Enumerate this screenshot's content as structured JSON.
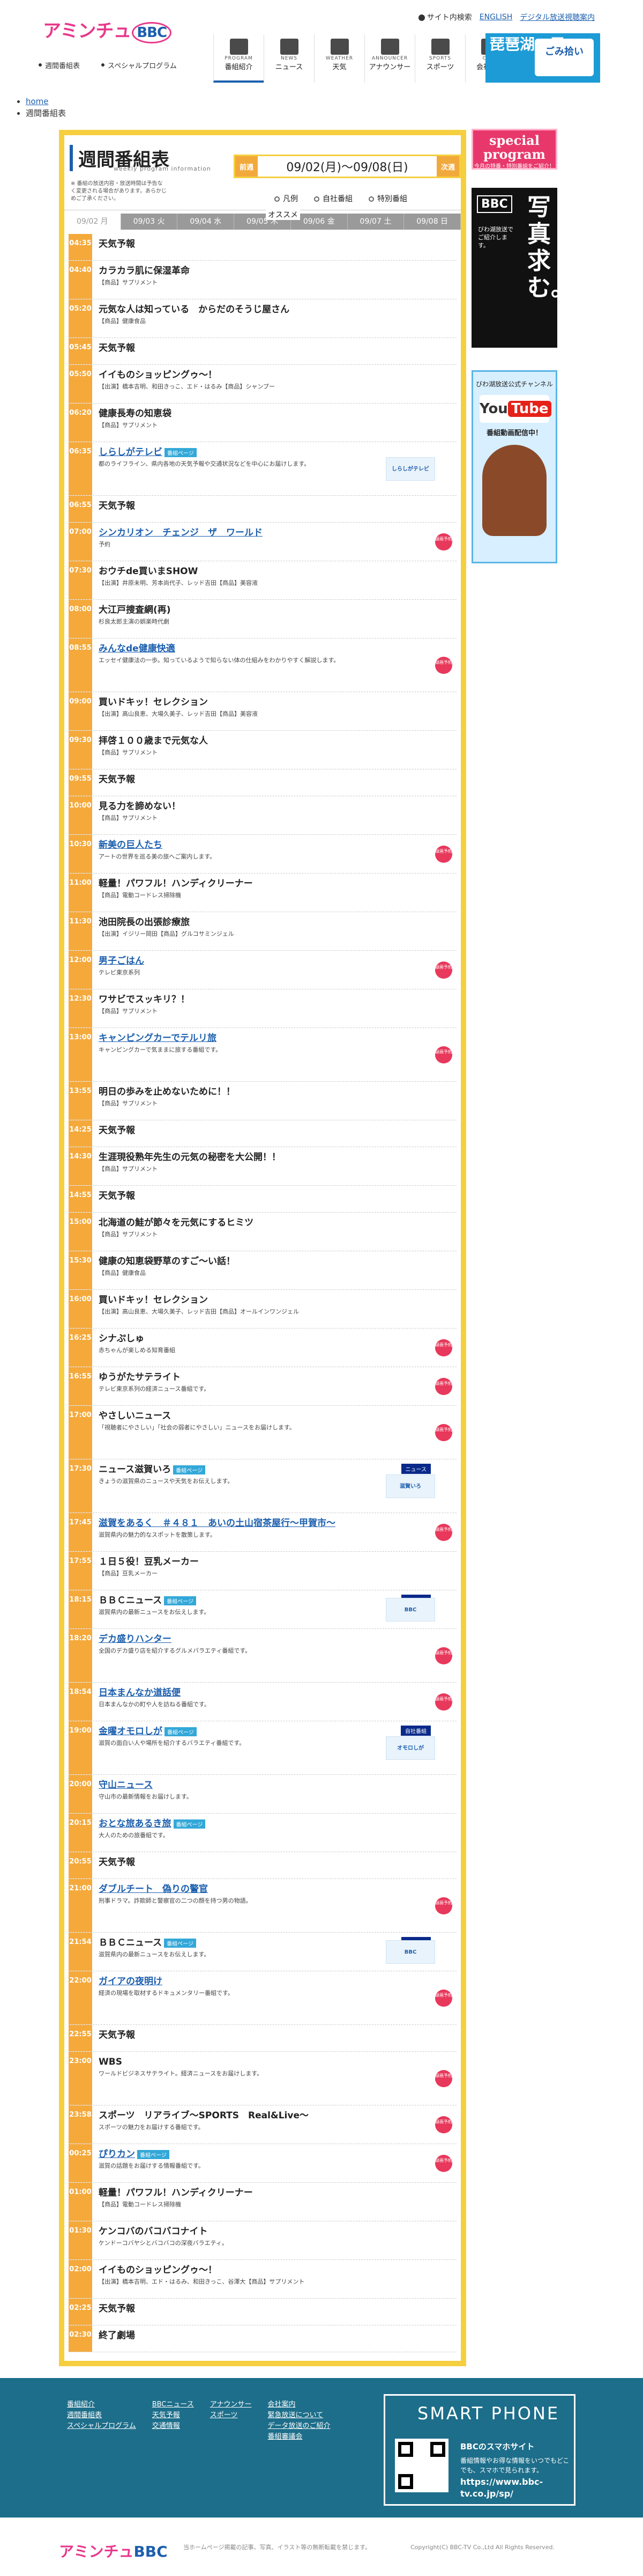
{
  "header": {
    "logo_text": "アミンチュ",
    "logo_bbc": "BBC",
    "sitemap": "サイト内検索",
    "english": "ENGLISH",
    "digital": "デジタル放送視聴案内",
    "nav": [
      {
        "en": "PROGRAM",
        "jp": "番組紹介",
        "icon": "tv-icon"
      },
      {
        "en": "NEWS",
        "jp": "ニュース",
        "icon": "news-icon"
      },
      {
        "en": "WEATHER",
        "jp": "天気",
        "icon": "weather-icon"
      },
      {
        "en": "ANNOUNCER",
        "jp": "アナウンサー",
        "icon": "microphone-icon"
      },
      {
        "en": "SPORTS",
        "jp": "スポーツ",
        "icon": "sports-icon"
      },
      {
        "en": "CORP",
        "jp": "会社案内",
        "icon": "building-icon"
      }
    ],
    "subnav": [
      "週間番組表",
      "スペシャルプログラム"
    ],
    "banner_title": "琵琶湖一周",
    "banner_sub": "ごみ拾い"
  },
  "breadcrumb": [
    "home",
    "週間番組表"
  ],
  "page": {
    "title": "週間番組表",
    "subtitle": "weekly program information",
    "note": "※ 番組の放送内容・放送時間は予告なく変更される場合があります。あらかじめご了承ください。",
    "prev": "前週",
    "next": "次週",
    "range": "09/02(月)〜09/08(日)",
    "legend": [
      "凡例",
      "自社番組",
      "特別番組"
    ],
    "osusume": "オススメ",
    "days": [
      "09/02 月",
      "09/03 火",
      "09/04 水",
      "09/05 木",
      "09/06 金",
      "09/07 土",
      "09/08 日"
    ]
  },
  "schedule": [
    {
      "time": "04:35",
      "title": "天気予報",
      "desc": ""
    },
    {
      "time": "04:40",
      "title": "カラカラ肌に保湿革命",
      "desc": "【商品】サプリメント"
    },
    {
      "time": "05:20",
      "title": "元気な人は知っている　からだのそうじ屋さん",
      "desc": "【商品】健康食品"
    },
    {
      "time": "05:45",
      "title": "天気予報",
      "desc": ""
    },
    {
      "time": "05:50",
      "title": "イイものショッピングゥ〜！",
      "desc": "【出演】橋本吉明、和田きっこ、エド・はるみ【商品】シャンプー"
    },
    {
      "time": "06:20",
      "title": "健康長寿の知恵袋",
      "desc": "【商品】サプリメント"
    },
    {
      "time": "06:35",
      "title": "しらしがテレビ",
      "desc": "都のライフライン、県内各地の天気予報や交通状況などを中心にお届けします。",
      "link": true,
      "hd": "番組ページ",
      "thumb": "しらしがテレビ"
    },
    {
      "time": "06:55",
      "title": "天気予報",
      "desc": ""
    },
    {
      "time": "07:00",
      "title": "シンカリオン　チェンジ　ザ　ワールド",
      "desc": "予約",
      "link": true,
      "rec": true
    },
    {
      "time": "07:30",
      "title": "おウチde買いまSHOW",
      "desc": "【出演】井原未明、芳本尚代子、レッド吉田【商品】美容液"
    },
    {
      "time": "08:00",
      "title": "大江戸捜査網(再)",
      "desc": "杉良太郎主演の娯楽時代劇"
    },
    {
      "time": "08:55",
      "title": "みんなde健康快適",
      "desc": "エッセイ健康法の一歩。知っているようで知らない体の仕組みをわかりやすく解説します。",
      "link": true,
      "rec": true
    },
    {
      "time": "09:00",
      "title": "買いドキッ！セレクション",
      "desc": "【出演】高山良恵、大場久美子、レッド吉田【商品】美容液"
    },
    {
      "time": "09:30",
      "title": "拝啓１００歳まで元気な人",
      "desc": "【商品】サプリメント"
    },
    {
      "time": "09:55",
      "title": "天気予報",
      "desc": ""
    },
    {
      "time": "10:00",
      "title": "見る力を諦めない！",
      "desc": "【商品】サプリメント"
    },
    {
      "time": "10:30",
      "title": "新美の巨人たち",
      "desc": "アートの世界を巡る美の旅へご案内します。",
      "link": true,
      "rec": true
    },
    {
      "time": "11:00",
      "title": "軽量！パワフル！ハンディクリーナー",
      "desc": "【商品】電動コードレス掃除機"
    },
    {
      "time": "11:30",
      "title": "池田院長の出張診療旅",
      "desc": "【出演】イジリー岡田【商品】グルコサミンジェル"
    },
    {
      "time": "12:00",
      "title": "男子ごはん",
      "desc": "テレビ東京系列",
      "link": true,
      "rec": true
    },
    {
      "time": "12:30",
      "title": "ワサビでスッキリ？！",
      "desc": "【商品】サプリメント"
    },
    {
      "time": "13:00",
      "title": "キャンピングカーでテルリ旅",
      "desc": "キャンピングカーで気ままに旅する番組です。",
      "link": true,
      "rec": true
    },
    {
      "time": "13:55",
      "title": "明日の歩みを止めないために！！",
      "desc": "【商品】サプリメント"
    },
    {
      "time": "14:25",
      "title": "天気予報",
      "desc": ""
    },
    {
      "time": "14:30",
      "title": "生涯現役熟年先生の元気の秘密を大公開！！",
      "desc": "【商品】サプリメント"
    },
    {
      "time": "14:55",
      "title": "天気予報",
      "desc": ""
    },
    {
      "time": "15:00",
      "title": "北海道の鮭が節々を元気にするヒミツ",
      "desc": "【商品】サプリメント"
    },
    {
      "time": "15:30",
      "title": "健康の知恵袋野草のすご〜い話！",
      "desc": "【商品】健康食品"
    },
    {
      "time": "16:00",
      "title": "買いドキッ！セレクション",
      "desc": "【出演】高山良恵、大場久美子、レッド吉田【商品】オールインワンジェル"
    },
    {
      "time": "16:25",
      "title": "シナぷしゅ",
      "desc": "赤ちゃんが楽しめる知育番組",
      "rec": true
    },
    {
      "time": "16:55",
      "title": "ゆうがたサテライト",
      "desc": "テレビ東京系列の経済ニュース番組です。",
      "rec": true
    },
    {
      "time": "17:00",
      "title": "やさしいニュース",
      "desc": "「視聴者にやさしい」「社会の弱者にやさしい」ニュースをお届けします。",
      "rec": true
    },
    {
      "time": "17:30",
      "title": "ニュース滋賀いろ",
      "desc": "きょうの滋賀県のニュースや天気をお伝えします。",
      "hd": "番組ページ",
      "news": "ニュース",
      "thumb": "滋賀いろ"
    },
    {
      "time": "17:45",
      "title": "滋賀をあるく　＃４８１　あいの土山宿茶屋行〜甲賀市〜",
      "desc": "滋賀県内の魅力的なスポットを散策します。",
      "link": true,
      "rec": true
    },
    {
      "time": "17:55",
      "title": "１日５役！豆乳メーカー",
      "desc": "【商品】豆乳メーカー"
    },
    {
      "time": "18:15",
      "title": "ＢＢＣニュース",
      "desc": "滋賀県内の最新ニュースをお伝えします。",
      "hd": "番組ページ",
      "news": "ニュース",
      "thumb": "BBC"
    },
    {
      "time": "18:20",
      "title": "デカ盛りハンター",
      "desc": "全国のデカ盛り店を紹介するグルメバラエティ番組です。",
      "link": true,
      "rec": true
    },
    {
      "time": "18:54",
      "title": "日本まんなか道話便",
      "desc": "日本まんなかの町や人を訪ねる番組です。",
      "link": true,
      "rec": true
    },
    {
      "time": "19:00",
      "title": "金曜オモロしが",
      "desc": "滋賀の面白い人や場所を紹介するバラエティ番組です。",
      "link": true,
      "hd": "番組ページ",
      "news": "自社番組",
      "thumb": "オモロしが"
    },
    {
      "time": "20:00",
      "title": "守山ニュース",
      "desc": "守山市の最新情報をお届けします。",
      "link": true
    },
    {
      "time": "20:15",
      "title": "おとな旅あるき旅",
      "desc": "大人のための旅番組です。",
      "link": true,
      "hd": "番組ページ"
    },
    {
      "time": "20:55",
      "title": "天気予報",
      "desc": ""
    },
    {
      "time": "21:00",
      "title": "ダブルチート　偽りの警官",
      "desc": "刑事ドラマ。詐欺師と警察官の二つの顔を持つ男の物語。",
      "link": true,
      "rec": true
    },
    {
      "time": "21:54",
      "title": "ＢＢＣニュース",
      "desc": "滋賀県内の最新ニュースをお伝えします。",
      "hd": "番組ページ",
      "news": "ニュース",
      "thumb": "BBC"
    },
    {
      "time": "22:00",
      "title": "ガイアの夜明け",
      "desc": "経済の現場を取材するドキュメンタリー番組です。",
      "link": true,
      "rec": true
    },
    {
      "time": "22:55",
      "title": "天気予報",
      "desc": ""
    },
    {
      "time": "23:00",
      "title": "WBS",
      "desc": "ワールドビジネスサテライト。経済ニュースをお届けします。",
      "rec": true
    },
    {
      "time": "23:58",
      "title": "スポーツ　リアライブ〜SPORTS　Real&Live〜",
      "desc": "スポーツの魅力をお届けする番組です。",
      "rec": true
    },
    {
      "time": "00:25",
      "title": "ぴりカン",
      "desc": "滋賀の話題をお届けする情報番組です。",
      "link": true,
      "hd": "番組ページ",
      "rec": true
    },
    {
      "time": "01:00",
      "title": "軽量！パワフル！ハンディクリーナー",
      "desc": "【商品】電動コードレス掃除機"
    },
    {
      "time": "01:30",
      "title": "ケンコバのバコバコナイト",
      "desc": "ケンドーコバヤシとバコバコの深夜バラエティ。"
    },
    {
      "time": "02:00",
      "title": "イイものショッピングゥ〜！",
      "desc": "【出演】橋本吉明、エド・はるみ、和田きっこ、谷澤大【商品】サプリメント"
    },
    {
      "time": "02:25",
      "title": "天気予報",
      "desc": ""
    },
    {
      "time": "02:30",
      "title": "終了劇場",
      "desc": ""
    }
  ],
  "sidebar": {
    "special_a": "special program",
    "special_b": "今月の特番・特別番組をご紹介！",
    "photo_logo": "BBC",
    "photo_big": "写真求む。",
    "photo_text": "びわ湖放送でご紹介します。",
    "yt_line1": "びわ湖放送公式チャンネル",
    "yt_logo1": "You",
    "yt_logo2": "Tube",
    "yt_line2": "番組動画配信中！"
  },
  "footer": {
    "col1": [
      "番組紹介",
      "週間番組表",
      "スペシャルプログラム"
    ],
    "col2": [
      "BBCニュース",
      "天気予報",
      "交通情報"
    ],
    "col3": [
      "アナウンサー",
      "スポーツ"
    ],
    "col4": [
      "会社案内",
      "緊急放送について",
      "データ放送のご紹介",
      "番組審議会"
    ],
    "smart_title": "SMART PHONE",
    "smart_name": "BBCのスマホサイト",
    "smart_desc": "番組情報やお得な情報をいつでもどこでも、スマホで見られます。",
    "smart_url": "https://www.bbc-tv.co.jp/sp/"
  },
  "bottom": {
    "note": "当ホームページ掲載の記事、写真、イラスト等の無断転載を禁じます。",
    "copy": "Copyright(C) BBC-TV Co.,Ltd All Rights Reserved."
  }
}
